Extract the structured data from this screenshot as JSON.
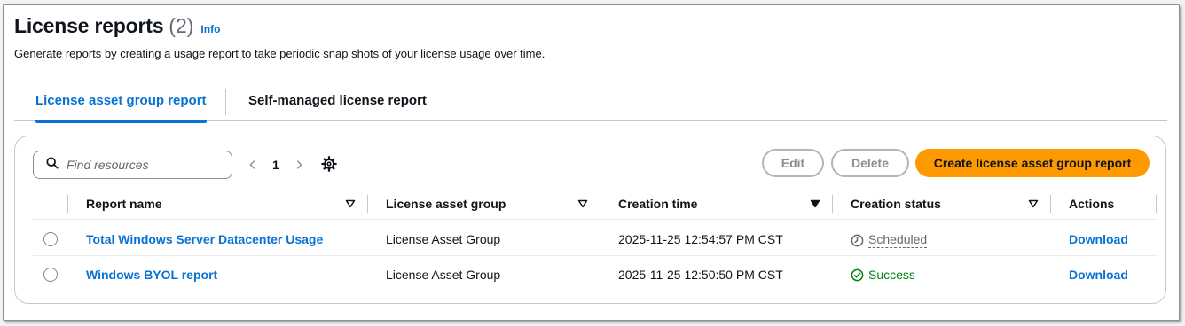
{
  "header": {
    "title": "License reports",
    "count": "(2)",
    "info_label": "Info",
    "description": "Generate reports by creating a usage report to take periodic snap shots of your license usage over time."
  },
  "tabs": [
    {
      "label": "License asset group report",
      "active": true
    },
    {
      "label": "Self-managed license report",
      "active": false
    }
  ],
  "toolbar": {
    "search_placeholder": "Find resources",
    "page": "1",
    "edit_label": "Edit",
    "delete_label": "Delete",
    "create_label": "Create license asset group report"
  },
  "table": {
    "columns": [
      "Report name",
      "License asset group",
      "Creation time",
      "Creation status",
      "Actions"
    ],
    "rows": [
      {
        "name": "Total Windows Server Datacenter Usage",
        "group": "License Asset Group",
        "time": "2025-11-25 12:54:57 PM CST",
        "status": "Scheduled",
        "status_icon": "clock-icon",
        "action": "Download"
      },
      {
        "name": "Windows BYOL report",
        "group": "License Asset Group",
        "time": "2025-11-25 12:50:50 PM CST",
        "status": "Success",
        "status_icon": "check-circle-icon",
        "action": "Download"
      }
    ]
  },
  "colors": {
    "accent": "#0972d3",
    "primary_button": "#ff9900",
    "success": "#037f0c",
    "muted": "#656871"
  }
}
